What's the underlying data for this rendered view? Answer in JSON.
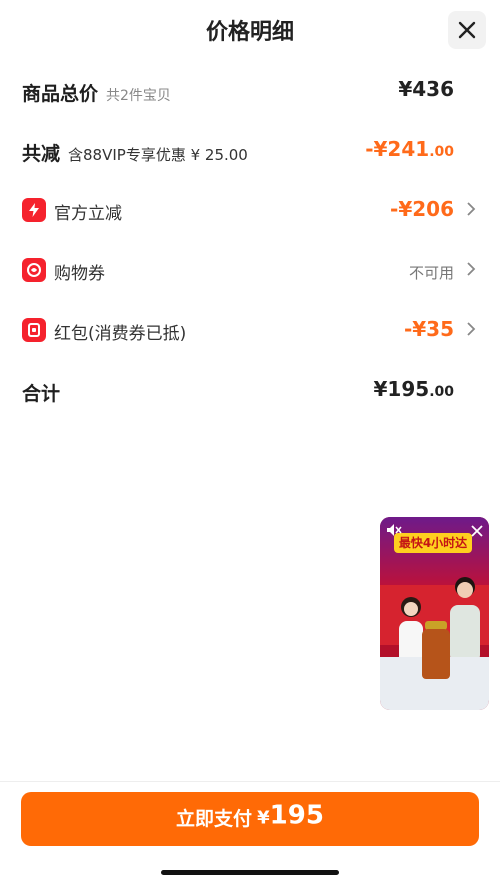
{
  "header": {
    "title": "价格明细"
  },
  "summary": {
    "total_label": "商品总价",
    "total_sub": "共2件宝贝",
    "total_amount": "¥436",
    "discount_label": "共减",
    "discount_sub": "含88VIP专享优惠 ¥ 25.00",
    "discount_amount_main": "-¥241",
    "discount_amount_dec": ".00"
  },
  "items": [
    {
      "label": "官方立减",
      "amount": "-¥206",
      "icon": "lightning-icon"
    },
    {
      "label": "购物券",
      "status": "不可用",
      "icon": "coupon-icon"
    },
    {
      "label": "红包(消费券已抵)",
      "amount": "-¥35",
      "icon": "red-packet-icon"
    }
  ],
  "grand_total": {
    "label": "合计",
    "amount_main": "¥195",
    "amount_dec": ".00"
  },
  "video": {
    "banner": "最快4小时达"
  },
  "pay": {
    "label": "立即支付",
    "yen": "¥",
    "amount": "195"
  },
  "colors": {
    "accent": "#ff6a06",
    "discount": "#ff6a1a",
    "icon_red": "#f5222d"
  }
}
